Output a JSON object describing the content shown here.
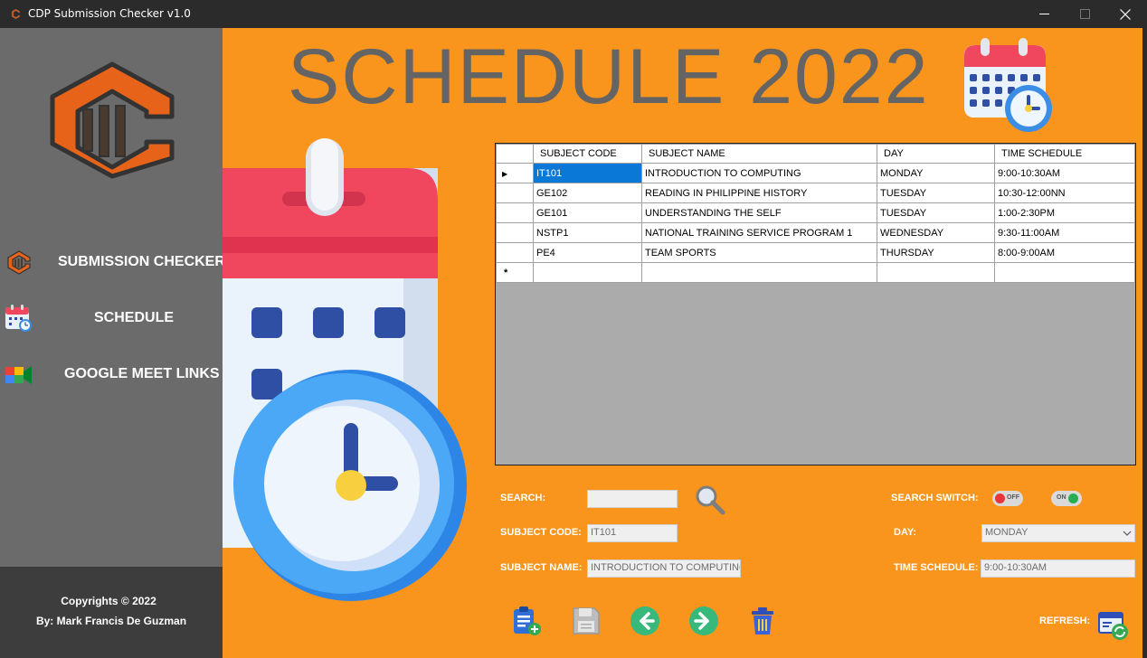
{
  "window": {
    "title": "CDP Submission Checker v1.0",
    "minimize_glyph": "—",
    "maximize_glyph": "☐",
    "close_glyph": "✕"
  },
  "sidebar": {
    "items": [
      {
        "label": "SUBMISSION CHECKER",
        "icon": "app-logo-icon"
      },
      {
        "label": "SCHEDULE",
        "icon": "calendar-icon"
      },
      {
        "label": "GOOGLE MEET LINKS",
        "icon": "google-meet-icon"
      }
    ],
    "footer": {
      "copyright": "Copyrights © 2022",
      "author": "By: Mark Francis De Guzman"
    }
  },
  "main": {
    "title": "SCHEDULE 2022"
  },
  "grid": {
    "columns": [
      "SUBJECT CODE",
      "SUBJECT NAME",
      "DAY",
      "TIME SCHEDULE"
    ],
    "rows": [
      [
        "IT101",
        "INTRODUCTION TO COMPUTING",
        "MONDAY",
        "9:00-10:30AM"
      ],
      [
        "GE102",
        "READING IN PHILIPPINE HISTORY",
        "TUESDAY",
        "10:30-12:00NN"
      ],
      [
        "GE101",
        "UNDERSTANDING THE SELF",
        "TUESDAY",
        "1:00-2:30PM"
      ],
      [
        "NSTP1",
        "NATIONAL TRAINING SERVICE PROGRAM 1",
        "WEDNESDAY",
        "9:30-11:00AM"
      ],
      [
        "PE4",
        "TEAM SPORTS",
        "THURSDAY",
        "8:00-9:00AM"
      ]
    ],
    "current_row_marker": "▶",
    "new_row_marker": "*"
  },
  "form": {
    "search_label": "SEARCH:",
    "search_value": "",
    "subject_code_label": "SUBJECT CODE:",
    "subject_code_value": "IT101",
    "subject_name_label": "SUBJECT NAME:",
    "subject_name_value": "INTRODUCTION TO COMPUTING",
    "search_switch_label": "SEARCH SWITCH:",
    "switch_off_text": "OFF",
    "switch_on_text": "ON",
    "day_label": "DAY:",
    "day_value": "MONDAY",
    "time_schedule_label": "TIME SCHEDULE:",
    "time_schedule_value": "9:00-10:30AM",
    "refresh_label": "REFRESH:"
  },
  "colors": {
    "accent_orange": "#f9951d",
    "sidebar": "#6b6b6b",
    "selection": "#0a78d7"
  }
}
